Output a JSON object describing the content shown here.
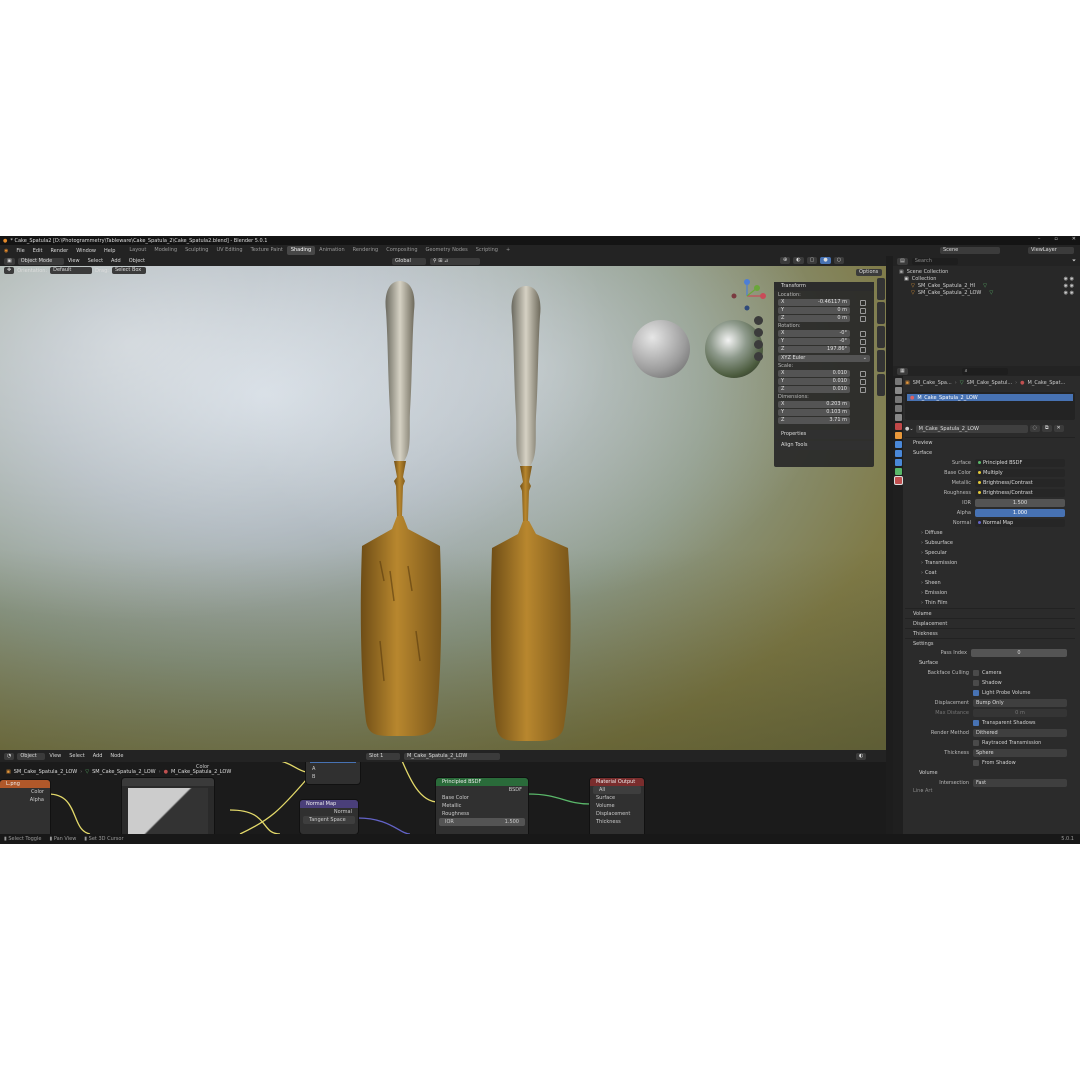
{
  "window": {
    "title": "* Cake_Spatula2 [D:\\Photogrammetry\\Tableware\\Cake_Spatula_2\\Cake_Spatula2.blend] - Blender 5.0.1",
    "controls": [
      "–",
      "▫",
      "✕"
    ]
  },
  "menu": [
    "File",
    "Edit",
    "Render",
    "Window",
    "Help"
  ],
  "workspaces": [
    "Layout",
    "Modeling",
    "Sculpting",
    "UV Editing",
    "Texture Paint",
    "Shading",
    "Animation",
    "Rendering",
    "Compositing",
    "Geometry Nodes",
    "Scripting"
  ],
  "active_workspace": "Shading",
  "scene": {
    "name": "Scene",
    "view_layer": "ViewLayer"
  },
  "viewport": {
    "mode": "Object Mode",
    "menus": [
      "View",
      "Select",
      "Add",
      "Object"
    ],
    "orientation_label": "Orientation:",
    "orientation": "Default",
    "drag_label": "Drag:",
    "drag": "Select Box",
    "transform_space": "Global",
    "options": "Options"
  },
  "npanel": {
    "title": "Transform",
    "location_label": "Location:",
    "location": [
      "-0.46117 m",
      "0 m",
      "0 m"
    ],
    "rotation_label": "Rotation:",
    "rotation": [
      "-0°",
      "-0°",
      "197.86°"
    ],
    "rotation_mode": "XYZ Euler",
    "scale_label": "Scale:",
    "scale": [
      "0.010",
      "0.010",
      "0.010"
    ],
    "dimensions_label": "Dimensions:",
    "dimensions": [
      "0.203 m",
      "0.103 m",
      "3.71 m"
    ],
    "axes": [
      "X",
      "Y",
      "Z"
    ],
    "properties": "Properties",
    "align_tools": "Align Tools",
    "tabs": [
      "Item",
      "Tool",
      "View",
      "Animation",
      "BlenderKit"
    ]
  },
  "outliner": {
    "search_placeholder": "Search",
    "root": "Scene Collection",
    "collection": "Collection",
    "objects": [
      "SM_Cake_Spatula_2_HI",
      "SM_Cake_Spatula_2_LOW"
    ]
  },
  "properties": {
    "breadcrumb": [
      "SM_Cake_Spa...",
      "SM_Cake_Spatul...",
      "M_Cake_Spat..."
    ],
    "slot": "M_Cake_Spatula_2_LOW",
    "material": "M_Cake_Spatula_2_LOW",
    "sections": {
      "preview": "Preview",
      "surface": "Surface"
    },
    "surface_label": "Surface",
    "surface_value": "Principled BSDF",
    "inputs": [
      {
        "label": "Base Color",
        "value": "Multiply"
      },
      {
        "label": "Metallic",
        "value": "Brightness/Contrast"
      },
      {
        "label": "Roughness",
        "value": "Brightness/Contrast"
      },
      {
        "label": "IOR",
        "value": "1.500"
      },
      {
        "label": "Alpha",
        "value": "1.000"
      },
      {
        "label": "Normal",
        "value": "Normal Map"
      }
    ],
    "subsections": [
      "Diffuse",
      "Subsurface",
      "Specular",
      "Transmission",
      "Coat",
      "Sheen",
      "Emission",
      "Thin Film"
    ],
    "more_sections": [
      "Volume",
      "Displacement",
      "Thickness",
      "Settings"
    ],
    "pass_index_label": "Pass Index",
    "pass_index": "0",
    "surface_sub": "Surface",
    "backface_label": "Backface Culling",
    "backface": [
      "Camera",
      "Shadow",
      "Light Probe Volume"
    ],
    "displacement_label": "Displacement",
    "displacement": "Bump Only",
    "max_distance_label": "Max Distance",
    "max_distance": "0 m",
    "transparent_shadows": "Transparent Shadows",
    "render_method_label": "Render Method",
    "render_method": "Dithered",
    "raytraced_transmission": "Raytraced Transmission",
    "thickness_label": "Thickness",
    "thickness": "Sphere",
    "from_shadow": "From Shadow",
    "volume_sub": "Volume",
    "intersection_label": "Intersection",
    "intersection": "Fast",
    "line_art": "Line Art"
  },
  "node_editor": {
    "type": "Object",
    "menus": [
      "View",
      "Select",
      "Add",
      "Node"
    ],
    "slot": "Slot 1",
    "material": "M_Cake_Spatula_2_LOW",
    "breadcrumb": [
      "SM_Cake_Spatula_2_LOW",
      "SM_Cake_Spatula_2_LOW",
      "M_Cake_Spatula_2_LOW"
    ],
    "image_node": {
      "name": "L.png",
      "outputs": [
        "Color",
        "Alpha"
      ]
    },
    "color_node": {
      "outputs": [
        "Color"
      ]
    },
    "small_node": {
      "labels": [
        "A",
        "B"
      ]
    },
    "normal_map": {
      "name": "Normal Map",
      "output": "Normal",
      "space": "Tangent Space"
    },
    "principled": {
      "name": "Principled BSDF",
      "output": "BSDF",
      "inputs": [
        "Base Color",
        "Metallic",
        "Roughness",
        "IOR"
      ],
      "ior": "1.500"
    },
    "output": {
      "name": "Material Output",
      "target": "All",
      "inputs": [
        "Surface",
        "Volume",
        "Displacement",
        "Thickness"
      ]
    }
  },
  "status": {
    "items": [
      "Select Toggle",
      "Pan View",
      "Set 3D Cursor"
    ],
    "version": "5.0.1"
  },
  "colors": {
    "accent": "#4772b3",
    "active_tab": "#474747",
    "bsdf_header": "#2a6b3a",
    "output_header": "#7a2d2d",
    "normal_header": "#4a3f7a",
    "image_header": "#b0582a"
  }
}
